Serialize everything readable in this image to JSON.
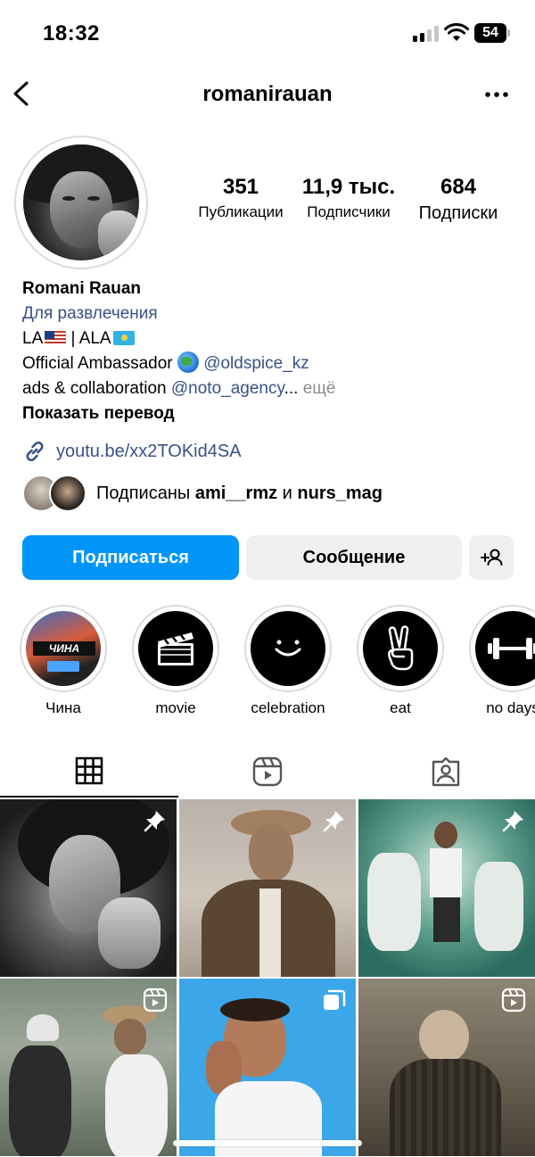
{
  "status_bar": {
    "time": "18:32",
    "battery": "54"
  },
  "header": {
    "username": "romanirauan"
  },
  "stats": [
    {
      "value": "351",
      "label": "Публикации"
    },
    {
      "value": "11,9 тыс.",
      "label": "Подписчики"
    },
    {
      "value": "684",
      "label": "Подписки"
    }
  ],
  "bio": {
    "name": "Romani Rauan",
    "category": "Для развлечения",
    "line_location_a": "LA",
    "line_location_sep": " |  ALA",
    "ambassador_text": "Official Ambassador ",
    "ambassador_mention": "@oldspice_kz",
    "ads_text": "ads & collaboration ",
    "ads_mention": "@noto_agency",
    "ellipsis": "...",
    "more": "ещё",
    "translate": "Показать перевод"
  },
  "link": {
    "text": "youtu.be/xx2TOKid4SA"
  },
  "followed_by": {
    "prefix": "Подписаны ",
    "user1": "ami__rmz",
    "and": " и ",
    "user2": "nurs_mag"
  },
  "buttons": {
    "follow": "Подписаться",
    "message": "Сообщение"
  },
  "highlights": [
    {
      "label": "Чина",
      "icon": "movie-poster",
      "poster_text": "ЧИНА"
    },
    {
      "label": "movie",
      "icon": "clapperboard-icon"
    },
    {
      "label": "celebration",
      "icon": "smile-icon"
    },
    {
      "label": "eat",
      "icon": "peace-hand-icon"
    },
    {
      "label": "no days",
      "icon": "dumbbell-icon"
    }
  ],
  "tabs": [
    {
      "name": "grid",
      "icon": "grid-icon",
      "active": true
    },
    {
      "name": "reels",
      "icon": "reels-icon",
      "active": false
    },
    {
      "name": "tagged",
      "icon": "tagged-icon",
      "active": false
    }
  ],
  "grid_posts": [
    {
      "badge": "pin-icon"
    },
    {
      "badge": "pin-icon"
    },
    {
      "badge": "pin-icon"
    },
    {
      "badge": "reels-icon"
    },
    {
      "badge": "carousel-icon"
    },
    {
      "badge": "reels-icon"
    }
  ],
  "colors": {
    "accent": "#0095f6",
    "link": "#385185",
    "muted": "#8e8e8e",
    "secondary_button": "#efefef"
  }
}
